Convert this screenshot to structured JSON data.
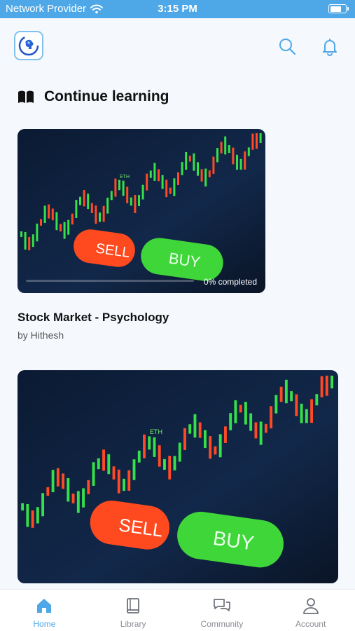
{
  "status_bar": {
    "carrier": "Network Provider",
    "time": "3:15 PM",
    "battery": 0.75
  },
  "header": {
    "logo_icon": "brain-head-icon",
    "search_icon": "search-icon",
    "notification_icon": "bell-icon"
  },
  "continue_learning": {
    "title": "Continue learning",
    "icon": "open-book-icon"
  },
  "courses": [
    {
      "title": "Stock Market - Psychology",
      "author": "by Hithesh",
      "progress_label": "0% completed",
      "progress": 0,
      "thumbnail_text": {
        "sell": "SELL",
        "buy": "BUY",
        "eth": "ETH"
      }
    },
    {
      "thumbnail_text": {
        "sell": "SELL",
        "buy": "BUY",
        "eth": "ETH"
      }
    }
  ],
  "bottom_nav": {
    "items": [
      {
        "label": "Home",
        "icon": "home-icon",
        "active": true
      },
      {
        "label": "Library",
        "icon": "book-icon",
        "active": false
      },
      {
        "label": "Community",
        "icon": "chat-bubbles-icon",
        "active": false
      },
      {
        "label": "Account",
        "icon": "user-icon",
        "active": false
      }
    ]
  },
  "colors": {
    "accent": "#4ea7e6",
    "background": "#f5f9fe",
    "sell": "#ff4a1f",
    "buy": "#3fd63a"
  }
}
